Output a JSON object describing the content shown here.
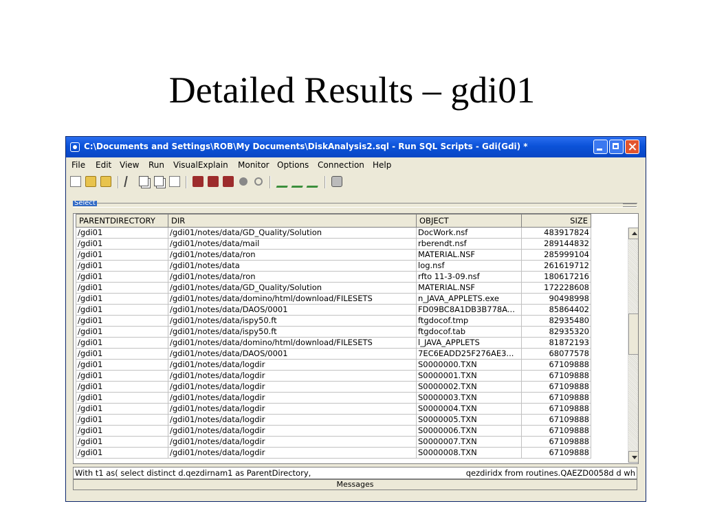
{
  "slide": {
    "title": "Detailed Results – gdi01"
  },
  "window": {
    "title": "C:\\Documents and Settings\\ROB\\My Documents\\DiskAnalysis2.sql - Run SQL Scripts - Gdi(Gdi) *"
  },
  "menu": [
    "File",
    "Edit",
    "View",
    "Run",
    "VisualExplain",
    "Monitor",
    "Options",
    "Connection",
    "Help"
  ],
  "toolbar": [
    "new-icon",
    "open-icon",
    "save-icon",
    "cut-icon",
    "copy-icon",
    "paste-icon",
    "run-icon",
    "run-all-icon",
    "run-selected-icon",
    "run-next-icon",
    "stop-icon",
    "cancel-icon",
    "explain-icon",
    "explain-run-icon",
    "explain-next-icon",
    "print-icon"
  ],
  "panel": {
    "select_label": "Select"
  },
  "table": {
    "columns": [
      "PARENTDIRECTORY",
      "DIR",
      "OBJECT",
      "SIZE"
    ],
    "rows": [
      [
        "/gdi01",
        "/gdi01/notes/data/GD_Quality/Solution",
        "DocWork.nsf",
        "483917824"
      ],
      [
        "/gdi01",
        "/gdi01/notes/data/mail",
        "rberendt.nsf",
        "289144832"
      ],
      [
        "/gdi01",
        "/gdi01/notes/data/ron",
        "MATERIAL.NSF",
        "285999104"
      ],
      [
        "/gdi01",
        "/gdi01/notes/data",
        "log.nsf",
        "261619712"
      ],
      [
        "/gdi01",
        "/gdi01/notes/data/ron",
        "rfto 11-3-09.nsf",
        "180617216"
      ],
      [
        "/gdi01",
        "/gdi01/notes/data/GD_Quality/Solution",
        "MATERIAL.NSF",
        "172228608"
      ],
      [
        "/gdi01",
        "/gdi01/notes/data/domino/html/download/FILESETS",
        "n_JAVA_APPLETS.exe",
        "90498998"
      ],
      [
        "/gdi01",
        "/gdi01/notes/data/DAOS/0001",
        "FD09BC8A1DB3B778A...",
        "85864402"
      ],
      [
        "/gdi01",
        "/gdi01/notes/data/ispy50.ft",
        "ftgdocof.tmp",
        "82935480"
      ],
      [
        "/gdi01",
        "/gdi01/notes/data/ispy50.ft",
        "ftgdocof.tab",
        "82935320"
      ],
      [
        "/gdi01",
        "/gdi01/notes/data/domino/html/download/FILESETS",
        "l_JAVA_APPLETS",
        "81872193"
      ],
      [
        "/gdi01",
        "/gdi01/notes/data/DAOS/0001",
        "7EC6EADD25F276AE3...",
        "68077578"
      ],
      [
        "/gdi01",
        "/gdi01/notes/data/logdir",
        "S0000000.TXN",
        "67109888"
      ],
      [
        "/gdi01",
        "/gdi01/notes/data/logdir",
        "S0000001.TXN",
        "67109888"
      ],
      [
        "/gdi01",
        "/gdi01/notes/data/logdir",
        "S0000002.TXN",
        "67109888"
      ],
      [
        "/gdi01",
        "/gdi01/notes/data/logdir",
        "S0000003.TXN",
        "67109888"
      ],
      [
        "/gdi01",
        "/gdi01/notes/data/logdir",
        "S0000004.TXN",
        "67109888"
      ],
      [
        "/gdi01",
        "/gdi01/notes/data/logdir",
        "S0000005.TXN",
        "67109888"
      ],
      [
        "/gdi01",
        "/gdi01/notes/data/logdir",
        "S0000006.TXN",
        "67109888"
      ],
      [
        "/gdi01",
        "/gdi01/notes/data/logdir",
        "S0000007.TXN",
        "67109888"
      ],
      [
        "/gdi01",
        "/gdi01/notes/data/logdir",
        "S0000008.TXN",
        "67109888"
      ]
    ]
  },
  "statement": {
    "left": "With t1 as( select distinct d.qezdirnam1 as ParentDirectory,",
    "right": "qezdiridx from routines.QAEZD0058d d wh"
  },
  "messages_tab": "Messages"
}
